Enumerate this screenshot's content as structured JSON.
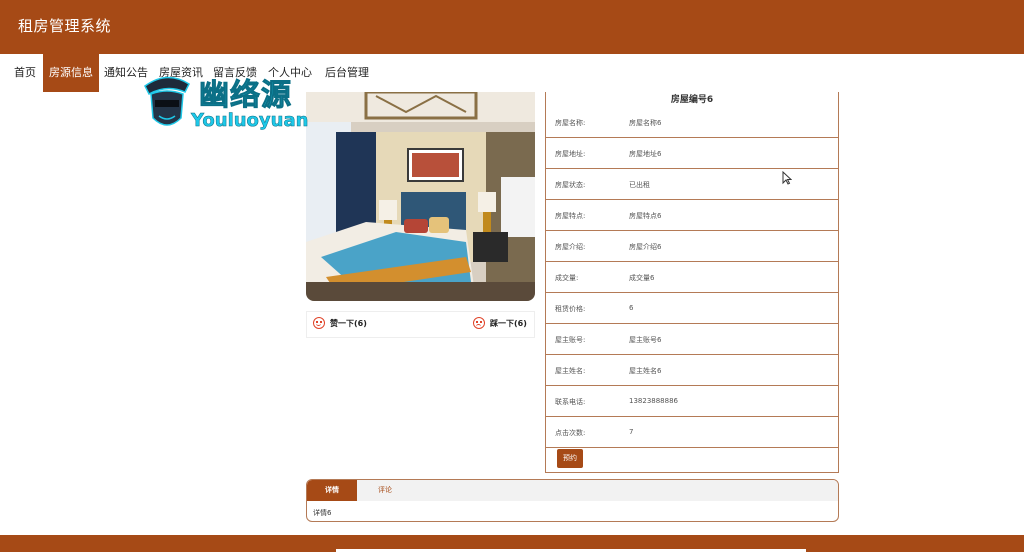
{
  "app": {
    "title": "租房管理系统"
  },
  "nav": [
    {
      "label": "首页",
      "active": false
    },
    {
      "label": "房源信息",
      "active": true
    },
    {
      "label": "通知公告",
      "active": false
    },
    {
      "label": "房屋资讯",
      "active": false
    },
    {
      "label": "留言反馈",
      "active": false
    },
    {
      "label": "个人中心",
      "active": false
    },
    {
      "label": "后台管理",
      "active": false
    }
  ],
  "watermark": {
    "cn": "幽络源",
    "en": "Youluoyuan"
  },
  "house": {
    "heading": "房屋编号6",
    "fields": [
      {
        "label": "房屋名称:",
        "value": "房屋名称6"
      },
      {
        "label": "房屋地址:",
        "value": "房屋地址6"
      },
      {
        "label": "房屋状态:",
        "value": "已出租"
      },
      {
        "label": "房屋特点:",
        "value": "房屋特点6"
      },
      {
        "label": "房屋介绍:",
        "value": "房屋介绍6"
      },
      {
        "label": "成交量:",
        "value": "成交量6"
      },
      {
        "label": "租赁价格:",
        "value": "6"
      },
      {
        "label": "屋主账号:",
        "value": "屋主账号6"
      },
      {
        "label": "屋主姓名:",
        "value": "屋主姓名6"
      },
      {
        "label": "联系电话:",
        "value": "13823888886"
      },
      {
        "label": "点击次数:",
        "value": "7"
      }
    ],
    "reserve_label": "预约"
  },
  "likes": {
    "up_label": "赞一下(6)",
    "down_label": "踩一下(6)"
  },
  "tabs": {
    "items": [
      "详情",
      "评论"
    ],
    "content": "详情6"
  },
  "colors": {
    "brand": "#a64a16",
    "border": "#b47a56",
    "watermark": "#1ec8e8"
  }
}
